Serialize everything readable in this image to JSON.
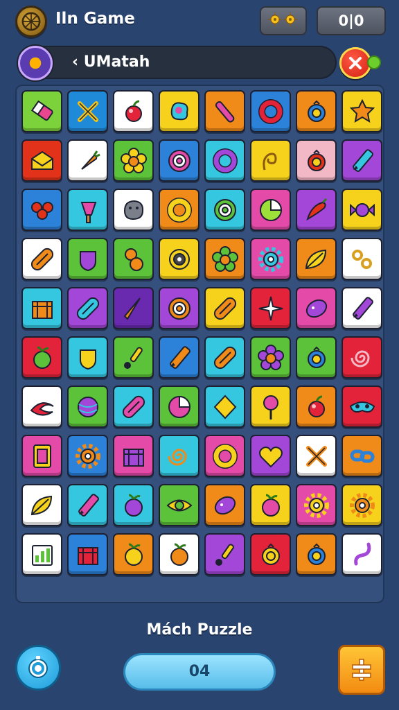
{
  "header": {
    "title": "Iln Game",
    "score": "0|0",
    "logo_icon": "game-logo-icon",
    "coins_icon": "gears-icon"
  },
  "nav": {
    "back_label": "‹  UMatah",
    "compass_icon": "compass-icon",
    "close_icon": "close-icon"
  },
  "board": {
    "columns": 8,
    "rows": 10,
    "tiles": [
      [
        {
          "bg": "#7bd23a",
          "icon": "eraser",
          "fg": "#e8478f"
        },
        {
          "bg": "#1f8ad8",
          "icon": "cross-sword",
          "fg": "#f2c318"
        },
        {
          "bg": "#ffffff",
          "icon": "cherry",
          "fg": "#e2233a"
        },
        {
          "bg": "#f6d21c",
          "icon": "blob",
          "fg": "#36c7e0"
        },
        {
          "bg": "#f08a18",
          "icon": "stick",
          "fg": "#e44aa8"
        },
        {
          "bg": "#2b82d8",
          "icon": "ring",
          "fg": "#e2233a"
        },
        {
          "bg": "#f08a18",
          "icon": "circle-ring",
          "fg": "#2b82d8"
        },
        {
          "bg": "#f6d21c",
          "icon": "star",
          "fg": "#f08a18"
        }
      ],
      [
        {
          "bg": "#e2331a",
          "icon": "envelope",
          "fg": "#f6d21c"
        },
        {
          "bg": "#ffffff",
          "icon": "carrot",
          "fg": "#f08a18"
        },
        {
          "bg": "#5bc23a",
          "icon": "flower",
          "fg": "#f6d21c"
        },
        {
          "bg": "#2b82d8",
          "icon": "target",
          "fg": "#e44aa8"
        },
        {
          "bg": "#36c7e0",
          "icon": "ring",
          "fg": "#a347d8"
        },
        {
          "bg": "#f6d21c",
          "icon": "swirl",
          "fg": "#8a5a10"
        },
        {
          "bg": "#f2b8c6",
          "icon": "circle-ring",
          "fg": "#e2331a"
        },
        {
          "bg": "#a347d8",
          "icon": "crayon",
          "fg": "#36c7e0"
        }
      ],
      [
        {
          "bg": "#2b82d8",
          "icon": "bow",
          "fg": "#e2331a"
        },
        {
          "bg": "#36c7e0",
          "icon": "popsicle",
          "fg": "#e44aa8"
        },
        {
          "bg": "#ffffff",
          "icon": "rock",
          "fg": "#7a7f8a"
        },
        {
          "bg": "#f08a18",
          "icon": "ring",
          "fg": "#f6d21c"
        },
        {
          "bg": "#36c7e0",
          "icon": "target",
          "fg": "#5bc23a"
        },
        {
          "bg": "#e44aa8",
          "icon": "pie",
          "fg": "#9ee03a"
        },
        {
          "bg": "#a347d8",
          "icon": "chili",
          "fg": "#e2331a"
        },
        {
          "bg": "#f6d21c",
          "icon": "candy",
          "fg": "#a347d8"
        }
      ],
      [
        {
          "bg": "#ffffff",
          "icon": "pill",
          "fg": "#f08a18"
        },
        {
          "bg": "#5bc23a",
          "icon": "shield",
          "fg": "#a347d8"
        },
        {
          "bg": "#5bc23a",
          "icon": "pear",
          "fg": "#f08a18"
        },
        {
          "bg": "#f6d21c",
          "icon": "dot-ring",
          "fg": "#444444"
        },
        {
          "bg": "#f08a18",
          "icon": "flower",
          "fg": "#5bc23a"
        },
        {
          "bg": "#e44aa8",
          "icon": "gear",
          "fg": "#36c7e0"
        },
        {
          "bg": "#f08a18",
          "icon": "leaf",
          "fg": "#f6d21c"
        },
        {
          "bg": "#ffffff",
          "icon": "dots",
          "fg": "#d9a020"
        }
      ],
      [
        {
          "bg": "#36c7e0",
          "icon": "box",
          "fg": "#f08a18"
        },
        {
          "bg": "#a347d8",
          "icon": "pill",
          "fg": "#36c7e0"
        },
        {
          "bg": "#6a2ab0",
          "icon": "cone",
          "fg": "#f08a18"
        },
        {
          "bg": "#a347d8",
          "icon": "target",
          "fg": "#f08a18"
        },
        {
          "bg": "#f6d21c",
          "icon": "pill",
          "fg": "#f08a18"
        },
        {
          "bg": "#e2233a",
          "icon": "spark",
          "fg": "#ffffff"
        },
        {
          "bg": "#e44aa8",
          "icon": "lemon",
          "fg": "#a347d8"
        },
        {
          "bg": "#ffffff",
          "icon": "crayon",
          "fg": "#a347d8"
        }
      ],
      [
        {
          "bg": "#e2233a",
          "icon": "apple",
          "fg": "#5bc23a"
        },
        {
          "bg": "#36c7e0",
          "icon": "shield",
          "fg": "#f6d21c"
        },
        {
          "bg": "#5bc23a",
          "icon": "brush",
          "fg": "#f6d21c"
        },
        {
          "bg": "#2b82d8",
          "icon": "crayon",
          "fg": "#f08a18"
        },
        {
          "bg": "#36c7e0",
          "icon": "pill",
          "fg": "#f08a18"
        },
        {
          "bg": "#5bc23a",
          "icon": "flower",
          "fg": "#a347d8"
        },
        {
          "bg": "#5bc23a",
          "icon": "circle-ring",
          "fg": "#2b82d8"
        },
        {
          "bg": "#e2233a",
          "icon": "spiral",
          "fg": "#f2b8c6"
        }
      ],
      [
        {
          "bg": "#ffffff",
          "icon": "swoosh",
          "fg": "#e2233a"
        },
        {
          "bg": "#5bc23a",
          "icon": "ball",
          "fg": "#a347d8"
        },
        {
          "bg": "#36c7e0",
          "icon": "pill",
          "fg": "#e44aa8"
        },
        {
          "bg": "#5bc23a",
          "icon": "pie",
          "fg": "#e44aa8"
        },
        {
          "bg": "#36c7e0",
          "icon": "diamond",
          "fg": "#f6d21c"
        },
        {
          "bg": "#f6d21c",
          "icon": "lollipop",
          "fg": "#e44aa8"
        },
        {
          "bg": "#f08a18",
          "icon": "cherry",
          "fg": "#e2233a"
        },
        {
          "bg": "#e2233a",
          "icon": "mask",
          "fg": "#36c7e0"
        }
      ],
      [
        {
          "bg": "#e44aa8",
          "icon": "card",
          "fg": "#f6d21c"
        },
        {
          "bg": "#2b82d8",
          "icon": "gear",
          "fg": "#f08a18"
        },
        {
          "bg": "#e44aa8",
          "icon": "box",
          "fg": "#a347d8"
        },
        {
          "bg": "#36c7e0",
          "icon": "spiral",
          "fg": "#f08a18"
        },
        {
          "bg": "#e44aa8",
          "icon": "ring",
          "fg": "#f6d21c"
        },
        {
          "bg": "#a347d8",
          "icon": "heart",
          "fg": "#f6d21c"
        },
        {
          "bg": "#ffffff",
          "icon": "cross-sword",
          "fg": "#f08a18"
        },
        {
          "bg": "#f08a18",
          "icon": "chain",
          "fg": "#2b82d8"
        }
      ],
      [
        {
          "bg": "#ffffff",
          "icon": "leaf",
          "fg": "#f6d21c"
        },
        {
          "bg": "#36c7e0",
          "icon": "crayon",
          "fg": "#e44aa8"
        },
        {
          "bg": "#36c7e0",
          "icon": "apple",
          "fg": "#a347d8"
        },
        {
          "bg": "#5bc23a",
          "icon": "eye",
          "fg": "#f6d21c"
        },
        {
          "bg": "#f08a18",
          "icon": "lemon",
          "fg": "#a347d8"
        },
        {
          "bg": "#f6d21c",
          "icon": "apple",
          "fg": "#e44aa8"
        },
        {
          "bg": "#e44aa8",
          "icon": "gear",
          "fg": "#f6d21c"
        },
        {
          "bg": "#f6d21c",
          "icon": "gear",
          "fg": "#f08a18"
        }
      ],
      [
        {
          "bg": "#ffffff",
          "icon": "chart",
          "fg": "#5bc23a"
        },
        {
          "bg": "#2b82d8",
          "icon": "box",
          "fg": "#e2233a"
        },
        {
          "bg": "#f08a18",
          "icon": "apple",
          "fg": "#f6d21c"
        },
        {
          "bg": "#ffffff",
          "icon": "apple",
          "fg": "#f08a18"
        },
        {
          "bg": "#a347d8",
          "icon": "brush",
          "fg": "#f6d21c"
        },
        {
          "bg": "#e2233a",
          "icon": "circle-ring",
          "fg": "#f6d21c"
        },
        {
          "bg": "#f08a18",
          "icon": "circle-ring",
          "fg": "#2b82d8"
        },
        {
          "bg": "#ffffff",
          "icon": "hook",
          "fg": "#a347d8"
        }
      ]
    ]
  },
  "footer": {
    "title": "Mách Puzzle",
    "moves": "04",
    "timer_icon": "timer-icon",
    "menu_icon": "menu-icon"
  }
}
